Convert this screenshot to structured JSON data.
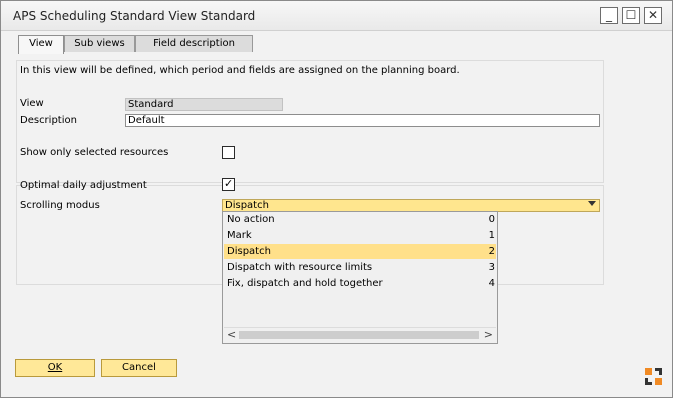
{
  "window": {
    "title": "APS Scheduling Standard View Standard",
    "controls": {
      "minimize": "_",
      "maximize": "☐",
      "close": "✕"
    }
  },
  "tabs": [
    {
      "label": "View",
      "active": true
    },
    {
      "label": "Sub views",
      "active": false
    },
    {
      "label": "Field description",
      "active": false
    }
  ],
  "info_text": "In this view will be defined, which period and fields are assigned on the planning board.",
  "form": {
    "view_label": "View",
    "view_value": "Standard",
    "description_label": "Description",
    "description_value": "Default",
    "show_selected_label": "Show only selected resources",
    "show_selected_checked": false,
    "optimal_label": "Optimal daily adjustment",
    "optimal_checked": true,
    "optimal_check_glyph": "✓",
    "scrolling_label": "Scrolling modus",
    "scrolling_value": "Dispatch"
  },
  "dropdown": {
    "options": [
      {
        "label": "No action",
        "value": "0"
      },
      {
        "label": "Mark",
        "value": "1"
      },
      {
        "label": "Dispatch",
        "value": "2",
        "selected": true
      },
      {
        "label": "Dispatch with resource limits",
        "value": "3"
      },
      {
        "label": "Fix, dispatch and hold together",
        "value": "4"
      }
    ],
    "scroll_left": "<",
    "scroll_right": ">"
  },
  "buttons": {
    "ok": "OK",
    "cancel": "Cancel"
  },
  "colors": {
    "accent": "#ffe898",
    "selection": "#ffe08a",
    "logo_orange": "#f08a24",
    "logo_dark": "#333333"
  }
}
